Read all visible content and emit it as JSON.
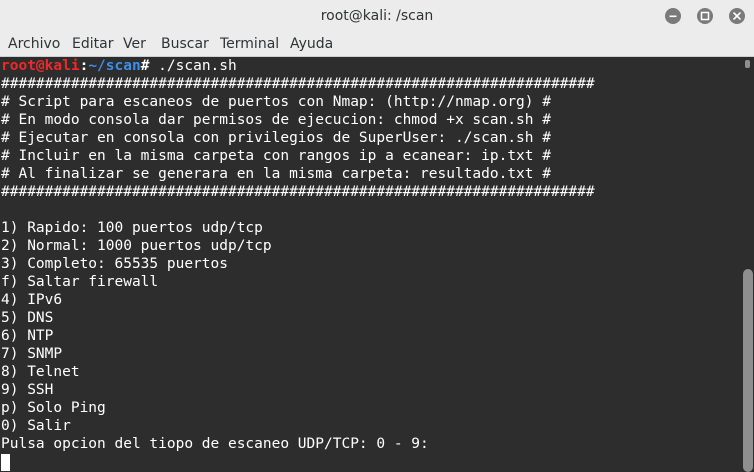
{
  "window": {
    "title": "root@kali: /scan",
    "controls": {
      "minimize": "minimize-icon",
      "maximize": "maximize-icon",
      "close": "close-icon"
    }
  },
  "menubar": {
    "items": [
      "Archivo",
      "Editar",
      "Ver",
      "Buscar",
      "Terminal",
      "Ayuda"
    ]
  },
  "terminal": {
    "prompt": {
      "user_host": "root@kali",
      "separator": ":",
      "path": "~/scan",
      "symbol": "#",
      "command": " ./scan.sh"
    },
    "lines": [
      "####################################################################",
      "# Script para escaneos de puertos con Nmap: (http://nmap.org) #",
      "# En modo consola dar permisos de ejecucion: chmod +x scan.sh #",
      "# Ejecutar en consola con privilegios de SuperUser: ./scan.sh #",
      "# Incluir en la misma carpeta con rangos ip a ecanear: ip.txt #",
      "# Al finalizar se generara en la misma carpeta: resultado.txt #",
      "####################################################################",
      "",
      "1) Rapido: 100 puertos udp/tcp",
      "2) Normal: 1000 puertos udp/tcp",
      "3) Completo: 65535 puertos",
      "f) Saltar firewall",
      "4) IPv6",
      "5) DNS",
      "6) NTP",
      "7) SNMP",
      "8) Telnet",
      "9) SSH",
      "p) Solo Ping",
      "0) Salir",
      "Pulsa opcion del tiopo de escaneo UDP/TCP: 0 - 9:"
    ]
  },
  "colors": {
    "terminal_bg": "#2d2d2d",
    "prompt_user": "#ef2929",
    "prompt_path": "#3b8eea",
    "text": "#ffffff"
  }
}
